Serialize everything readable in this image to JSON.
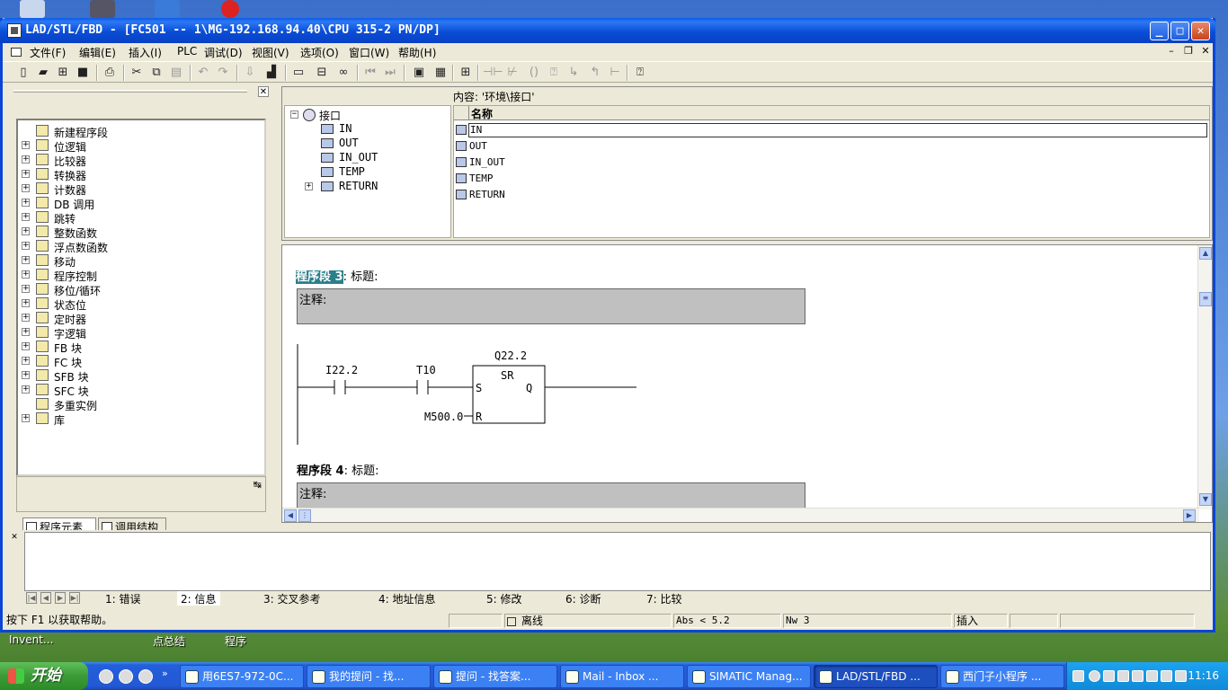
{
  "window": {
    "title": "LAD/STL/FBD  - [FC501 -- 1\\MG-192.168.94.40\\CPU 315-2 PN/DP]"
  },
  "menu": {
    "items": [
      "文件(F)",
      "编辑(E)",
      "插入(I)",
      "PLC",
      "调试(D)",
      "视图(V)",
      "选项(O)",
      "窗口(W)",
      "帮助(H)"
    ]
  },
  "program_elements": {
    "items": [
      {
        "label": "新建程序段",
        "icon": "new-network-icon",
        "expandable": false
      },
      {
        "label": "位逻辑",
        "icon": "bit-logic-icon",
        "expandable": true
      },
      {
        "label": "比较器",
        "icon": "comparator-icon",
        "expandable": true
      },
      {
        "label": "转换器",
        "icon": "converter-icon",
        "expandable": true
      },
      {
        "label": "计数器",
        "icon": "counter-icon",
        "expandable": true
      },
      {
        "label": "DB 调用",
        "icon": "db-call-icon",
        "expandable": true
      },
      {
        "label": "跳转",
        "icon": "jump-icon",
        "expandable": true
      },
      {
        "label": "整数函数",
        "icon": "integer-function-icon",
        "expandable": true
      },
      {
        "label": "浮点数函数",
        "icon": "float-function-icon",
        "expandable": true
      },
      {
        "label": "移动",
        "icon": "move-icon",
        "expandable": true
      },
      {
        "label": "程序控制",
        "icon": "program-control-icon",
        "expandable": true
      },
      {
        "label": "移位/循环",
        "icon": "shift-rotate-icon",
        "expandable": true
      },
      {
        "label": "状态位",
        "icon": "status-bit-icon",
        "expandable": true
      },
      {
        "label": "定时器",
        "icon": "timer-icon",
        "expandable": true
      },
      {
        "label": "字逻辑",
        "icon": "word-logic-icon",
        "expandable": true
      },
      {
        "label": "FB 块",
        "icon": "fb-block-icon",
        "expandable": true
      },
      {
        "label": "FC 块",
        "icon": "fc-block-icon",
        "expandable": true
      },
      {
        "label": "SFB 块",
        "icon": "sfb-block-icon",
        "expandable": true
      },
      {
        "label": "SFC 块",
        "icon": "sfc-block-icon",
        "expandable": true
      },
      {
        "label": "多重实例",
        "icon": "multi-instance-icon",
        "expandable": false
      },
      {
        "label": "库",
        "icon": "library-icon",
        "expandable": true
      }
    ],
    "tabs": [
      "程序元素",
      "调用结构"
    ]
  },
  "interface": {
    "root": "接口",
    "tree": [
      "IN",
      "OUT",
      "IN_OUT",
      "TEMP",
      "RETURN"
    ],
    "content_label": "内容: '环境\\接口'",
    "column_name": "名称",
    "rows": [
      "IN",
      "OUT",
      "IN_OUT",
      "TEMP",
      "RETURN"
    ]
  },
  "editor": {
    "network3": {
      "label": "程序段 3",
      "title": ": 标题:",
      "comment": "注释:"
    },
    "network4": {
      "label": "程序段 4",
      "title": ": 标题:",
      "comment": "注释:"
    },
    "ladder": {
      "contact1": "I22.2",
      "contact2": "T10",
      "coil_address": "Q22.2",
      "box_type": "SR",
      "pin_s": "S",
      "pin_q": "Q",
      "pin_r": "R",
      "reset_operand": "M500.0"
    }
  },
  "output": {
    "tabs": [
      "1: 错误",
      "2: 信息",
      "3: 交叉参考",
      "4: 地址信息",
      "5: 修改",
      "6: 诊断",
      "7: 比较"
    ],
    "active_tab": 1
  },
  "status": {
    "help": "按下 F1 以获取帮助。",
    "mode": "离线",
    "abs": "Abs < 5.2",
    "nw": "Nw 3",
    "insert": "插入"
  },
  "desktop": {
    "labels": [
      "Invent...",
      "点总结",
      "程序"
    ]
  },
  "taskbar": {
    "start": "开始",
    "tasks": [
      "用6ES7-972-0C...",
      "我的提问 - 找...",
      "提问 - 找答案...",
      "Mail - Inbox ...",
      "SIMATIC Manag...",
      "LAD/STL/FBD ...",
      "西门子小程序 ..."
    ],
    "active_task": 5,
    "clock": "11:16"
  }
}
